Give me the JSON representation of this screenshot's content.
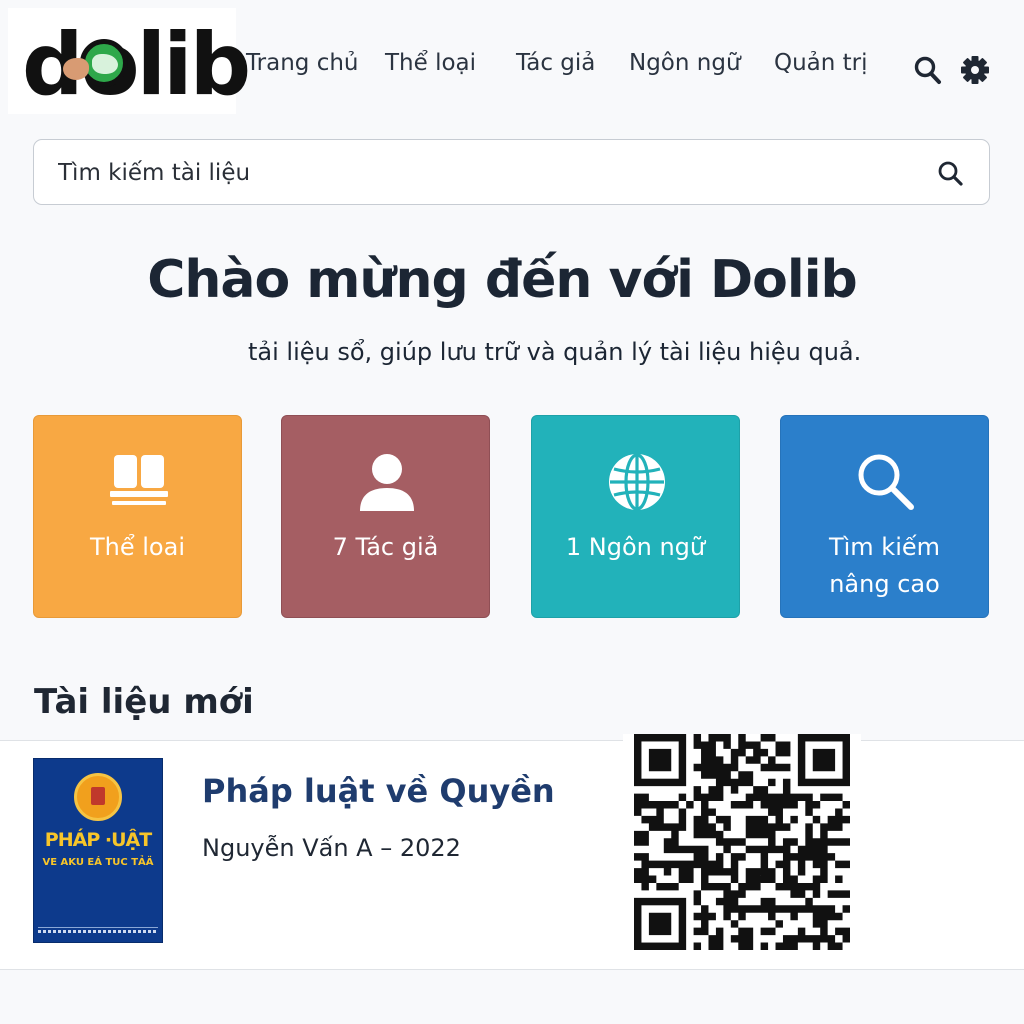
{
  "brand": {
    "logo_text": "dolib"
  },
  "nav": {
    "home": "Trang chủ",
    "categories": "Thể loại",
    "authors": "Tác giả",
    "languages": "Ngôn ngữ",
    "admin": "Quản trị"
  },
  "header_icons": [
    "search-icon",
    "gear-icon"
  ],
  "search": {
    "placeholder": "Tìm kiếm tài liệu"
  },
  "hero": {
    "title": "Chào mừng đến với Dolib",
    "subtitle": "tải liệu sổ, giúp lưu trữ và quản lý tài liệu hiệu quả."
  },
  "tiles": [
    {
      "label": "Thể loai",
      "icon": "book-icon",
      "color": "#f8a843"
    },
    {
      "label": "7 Tác giả",
      "icon": "user-icon",
      "color": "#a55e63"
    },
    {
      "label": "1 Ngôn ngữ",
      "icon": "globe-icon",
      "color": "#22b2ba"
    },
    {
      "label_line1": "Tìm kiếm",
      "label_line2": "nâng cao",
      "icon": "search-icon",
      "color": "#2b7fcb"
    }
  ],
  "latest": {
    "heading": "Tài liệu mới",
    "items": [
      {
        "title": "Pháp luật về Quyền",
        "meta": "Nguyễn Vấn A – 2022",
        "cover_title": "PHÁP ·UẬT",
        "cover_subtitle": "VE AKU EÁ TUC TẢÄ",
        "qr": "qr-code"
      }
    ]
  }
}
